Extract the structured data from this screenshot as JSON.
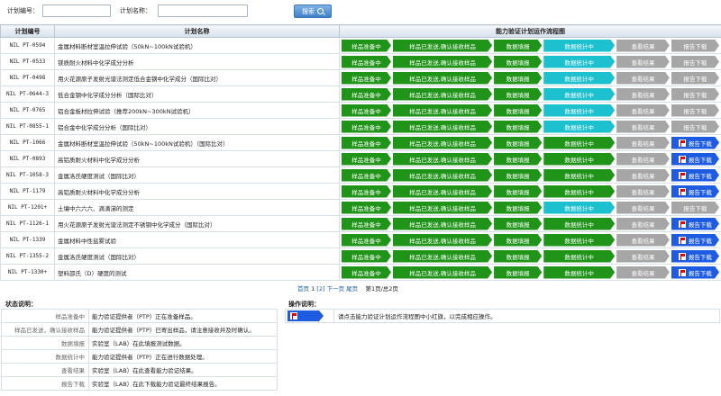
{
  "search": {
    "code_label": "计划编号：",
    "name_label": "计划名称：",
    "code_value": "",
    "name_value": "",
    "button_label": "搜索"
  },
  "table": {
    "headers": [
      "计划编号",
      "计划名称",
      "能力验证计划运作流程图"
    ],
    "rows": [
      {
        "code": "NIL PT-0594",
        "name": "金属材料断材室温拉伸试验（50kN~100kN试验机）",
        "steps": [
          "green",
          "green",
          "green",
          "cyan",
          "gray",
          "gray"
        ],
        "flag": false
      },
      {
        "code": "NIL PT-0533",
        "name": "镁质耐火材料中化学成分分析",
        "steps": [
          "green",
          "green",
          "green",
          "cyan",
          "gray",
          "gray"
        ],
        "flag": false
      },
      {
        "code": "NIL PT-0498",
        "name": "用火花源原子发射光谱法测定低合金钢中化学成分（国际比对）",
        "steps": [
          "green",
          "green",
          "green",
          "cyan",
          "gray",
          "gray"
        ],
        "flag": false
      },
      {
        "code": "NIL PT-0644-3",
        "name": "低合金钢中化学成分分析（国际比对）",
        "steps": [
          "green",
          "green",
          "green",
          "cyan",
          "gray",
          "gray"
        ],
        "flag": false
      },
      {
        "code": "NIL PT-0765",
        "name": "铝合金板材拉伸试验（推荐200kN~300kN试验机）",
        "steps": [
          "green",
          "green",
          "green",
          "cyan",
          "gray",
          "gray"
        ],
        "flag": false
      },
      {
        "code": "NIL PT-0855-1",
        "name": "铝合金中化学成分分析（国际比对）",
        "steps": [
          "green",
          "green",
          "green",
          "cyan",
          "gray",
          "gray"
        ],
        "flag": false
      },
      {
        "code": "NIL PT-1066",
        "name": "金属材料断材室温拉伸试验（50kN~100kN试验机）（国际比对）",
        "steps": [
          "green",
          "green",
          "green",
          "green",
          "gray",
          "blue"
        ],
        "flag": true
      },
      {
        "code": "NIL PT-0893",
        "name": "高铝质耐火材料中化学成分分析",
        "steps": [
          "green",
          "green",
          "green",
          "green",
          "gray",
          "blue"
        ],
        "flag": true
      },
      {
        "code": "NIL PT-1058-3",
        "name": "金属洛氏硬度测试（国际比对）",
        "steps": [
          "green",
          "green",
          "green",
          "green",
          "gray",
          "blue"
        ],
        "flag": true
      },
      {
        "code": "NIL PT-1179",
        "name": "高铝质耐火材料中化学成分分析",
        "steps": [
          "green",
          "green",
          "green",
          "green",
          "gray",
          "blue"
        ],
        "flag": true
      },
      {
        "code": "NIL PT-1201+",
        "name": "土壤中六六六、滴滴涕的测定",
        "steps": [
          "green",
          "green",
          "green",
          "cyan",
          "gray",
          "gray"
        ],
        "flag": false
      },
      {
        "code": "NIL PT-1126-1",
        "name": "用火花源原子发射光谱法测定不锈钢中化学成分（国际比对）",
        "steps": [
          "green",
          "green",
          "green",
          "green",
          "gray",
          "blue"
        ],
        "flag": true
      },
      {
        "code": "NIL PT-1339",
        "name": "金属材料中性盐雾试验",
        "steps": [
          "green",
          "green",
          "green",
          "green",
          "gray",
          "blue"
        ],
        "flag": true
      },
      {
        "code": "NIL PT-1355-2",
        "name": "金属洛氏硬度测试（国际比对）",
        "steps": [
          "green",
          "green",
          "green",
          "green",
          "gray",
          "blue"
        ],
        "flag": true
      },
      {
        "code": "NIL PT-1330+",
        "name": "塑料邵氏（D）硬度的测试",
        "steps": [
          "green",
          "green",
          "green",
          "green",
          "gray",
          "blue"
        ],
        "flag": true
      }
    ],
    "step_labels": [
      "样品准备中",
      "样品已发送,确认接收样品",
      "数据填报",
      "数据统计中",
      "查看结果",
      "报告下载"
    ]
  },
  "pager": {
    "first": "首页",
    "page1": "1",
    "page2": "[2]",
    "next": "下一页",
    "last": "尾页",
    "info": "第1页/总2页"
  },
  "legend": {
    "status_title": "状态说明：",
    "items": [
      {
        "k": "样品准备中",
        "v": "能力验证提供者（PTP）正在准备样品。"
      },
      {
        "k": "样品已发送，确认接收样品",
        "v": "能力验证提供者（PTP）已寄出样品，请注意接收并及时确认。"
      },
      {
        "k": "数据填报",
        "v": "实验室（LAB）在此填报测试数据。"
      },
      {
        "k": "数据统计中",
        "v": "能力验证提供者（PTP）正在进行数据处理。"
      },
      {
        "k": "查看结果",
        "v": "实验室（LAB）在此查看能力验证结果。"
      },
      {
        "k": "报告下载",
        "v": "实验室（LAB）在此下载能力验证最终结果报告。"
      }
    ],
    "op_title": "操作说明：",
    "op_text": "请点击能力验证计划运作流程图中小红旗，以完成相应操作。"
  },
  "colors": {
    "green": "#1f9419",
    "cyan": "#1cc0cf",
    "gray": "#a6a6a6",
    "blue": "#1d5be0",
    "flag_red": "#e00000"
  }
}
